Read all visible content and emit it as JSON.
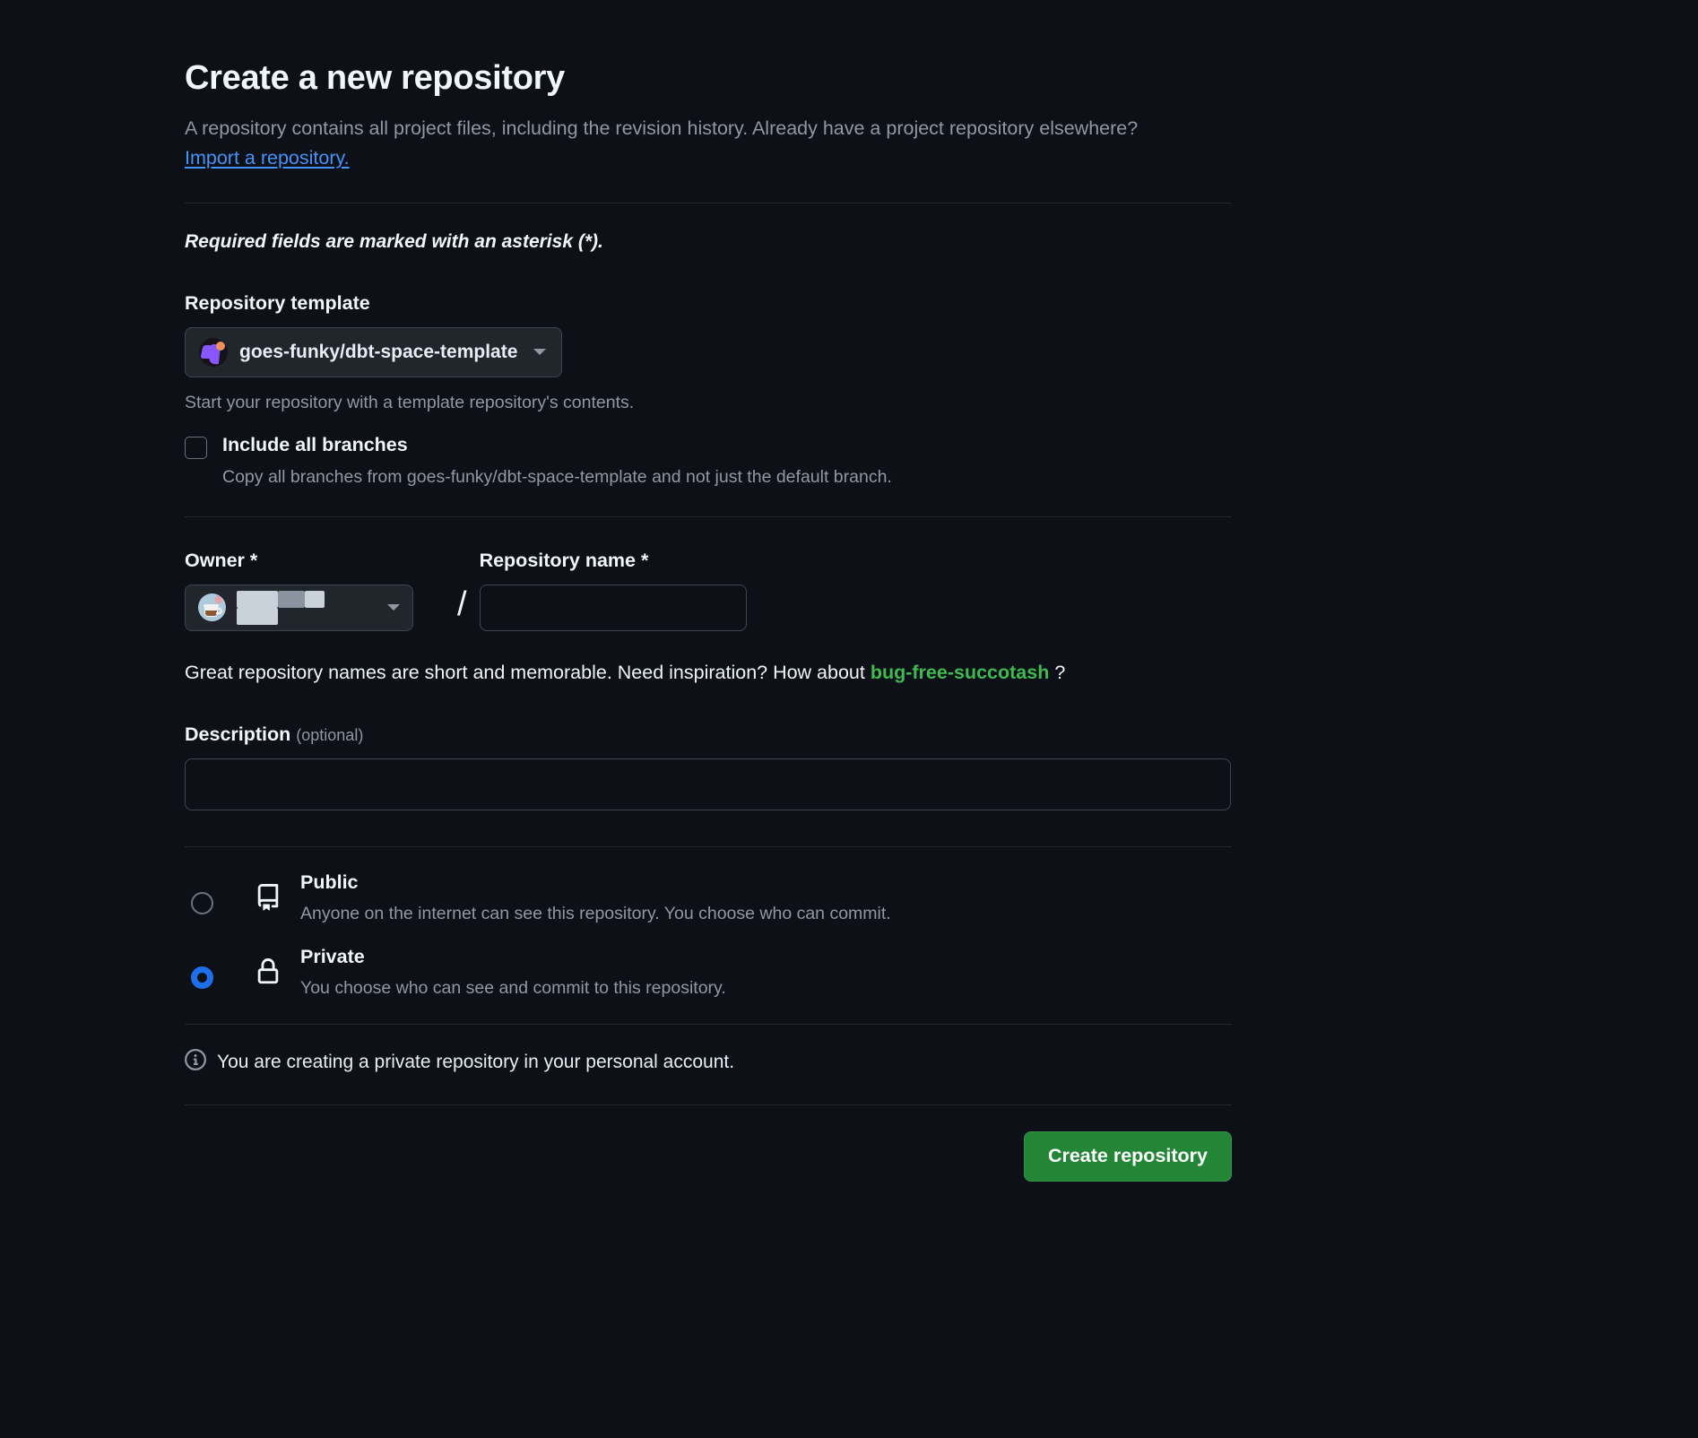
{
  "page": {
    "title": "Create a new repository",
    "intro_before_link": "A repository contains all project files, including the revision history. Already have a project repository elsewhere? ",
    "import_link": "Import a repository.",
    "required_note": "Required fields are marked with an asterisk (*)."
  },
  "template": {
    "label": "Repository template",
    "selected": "goes-funky/dbt-space-template",
    "caret_icon": "chevron-down-icon",
    "avatar_icon": "org-avatar-icon",
    "help": "Start your repository with a template repository's contents.",
    "include_all_branches_label": "Include all branches",
    "include_all_branches_checked": false,
    "include_all_branches_help": "Copy all branches from goes-funky/dbt-space-template and not just the default branch."
  },
  "owner": {
    "label": "Owner *",
    "avatar_icon": "user-avatar-icon",
    "value": "",
    "caret_icon": "chevron-down-icon",
    "separator": "/"
  },
  "repository_name": {
    "label": "Repository name *",
    "value": "",
    "placeholder": ""
  },
  "suggestion": {
    "prefix": "Great repository names are short and memorable. Need inspiration? How about ",
    "name": "bug-free-succotash",
    "suffix": " ?"
  },
  "description": {
    "label": "Description",
    "optional": "(optional)",
    "value": "",
    "placeholder": ""
  },
  "visibility": {
    "selected": "private",
    "options": [
      {
        "id": "public",
        "title": "Public",
        "description": "Anyone on the internet can see this repository. You choose who can commit.",
        "icon": "repo-book-icon",
        "selected": false
      },
      {
        "id": "private",
        "title": "Private",
        "description": "You choose who can see and commit to this repository.",
        "icon": "lock-icon",
        "selected": true
      }
    ]
  },
  "info_note": {
    "icon": "info-circle-icon",
    "text": "You are creating a private repository in your personal account."
  },
  "footer": {
    "create_label": "Create repository"
  },
  "colors": {
    "background": "#0d1117",
    "accent_blue": "#1f6feb",
    "link_blue": "#4493f8",
    "success_green": "#238636",
    "suggestion_green": "#3fb950",
    "muted_text": "#9198a1",
    "primary_text": "#f0f6fc",
    "border": "#3d444d"
  }
}
